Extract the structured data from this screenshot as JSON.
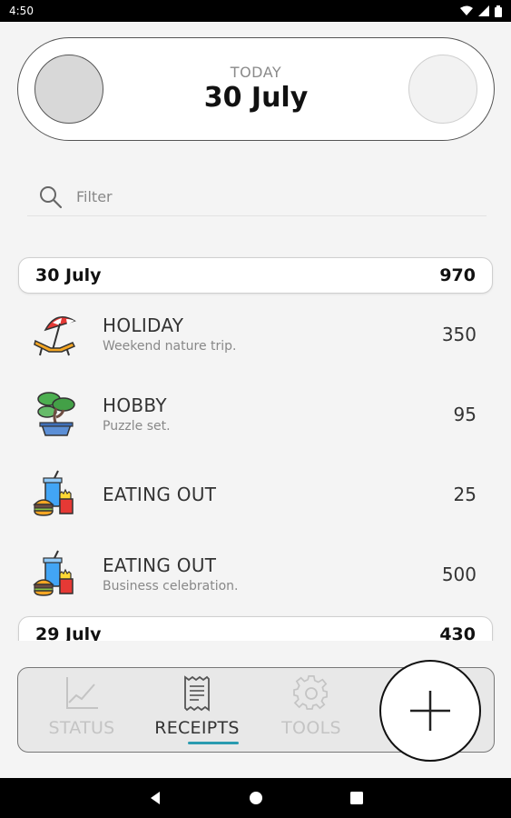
{
  "status_bar": {
    "time": "4:50"
  },
  "date_card": {
    "label": "TODAY",
    "date": "30 July"
  },
  "filter": {
    "placeholder": "Filter",
    "value": ""
  },
  "groups": [
    {
      "date": "30 July",
      "total": "970",
      "entries": [
        {
          "title": "HOLIDAY",
          "subtitle": "Weekend nature trip.",
          "amount": "350",
          "icon": "beach-umbrella-icon"
        },
        {
          "title": "HOBBY",
          "subtitle": "Puzzle set.",
          "amount": "95",
          "icon": "bonsai-tree-icon"
        },
        {
          "title": "EATING OUT",
          "subtitle": "",
          "amount": "25",
          "icon": "fast-food-icon"
        },
        {
          "title": "EATING OUT",
          "subtitle": "Business celebration.",
          "amount": "500",
          "icon": "fast-food-icon"
        }
      ]
    },
    {
      "date": "29 July",
      "total": "430"
    }
  ],
  "bottom_nav": {
    "tabs": [
      {
        "label": "STATUS",
        "icon": "chart-icon",
        "active": false
      },
      {
        "label": "RECEIPTS",
        "icon": "receipt-icon",
        "active": true
      },
      {
        "label": "TOOLS",
        "icon": "gear-icon",
        "active": false
      }
    ],
    "accent_color": "#2a9bb0"
  },
  "fab": {
    "icon": "plus-icon"
  },
  "system_nav": {
    "icons": [
      "back-icon",
      "home-icon",
      "recents-icon"
    ]
  }
}
